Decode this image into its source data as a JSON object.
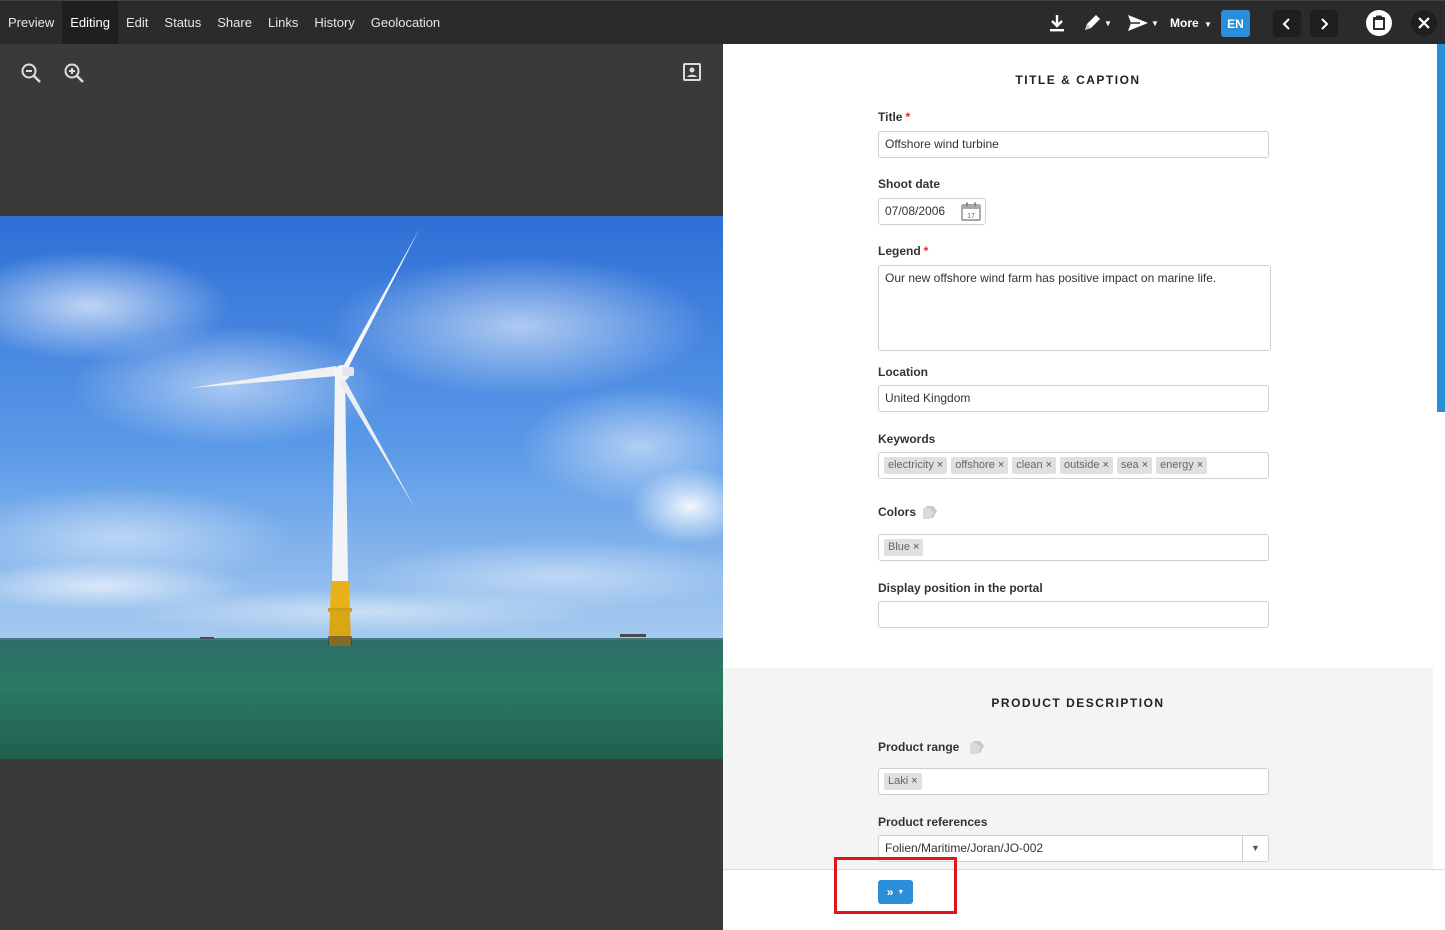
{
  "topbar": {
    "tabs": [
      {
        "label": "Preview",
        "active": false
      },
      {
        "label": "Editing",
        "active": true
      },
      {
        "label": "Edit",
        "active": false
      },
      {
        "label": "Status",
        "active": false
      },
      {
        "label": "Share",
        "active": false
      },
      {
        "label": "Links",
        "active": false
      },
      {
        "label": "History",
        "active": false
      },
      {
        "label": "Geolocation",
        "active": false
      }
    ],
    "more_label": "More",
    "language_label": "EN",
    "accent_color": "#2a8fd8"
  },
  "title_caption": {
    "heading": "TITLE & CAPTION",
    "title_label": "Title",
    "title_value": "Offshore wind turbine",
    "shoot_date_label": "Shoot date",
    "shoot_date_value": "07/08/2006",
    "calendar_day": "17",
    "legend_label": "Legend",
    "legend_value": "Our new offshore wind farm has positive impact on marine life.",
    "location_label": "Location",
    "location_value": "United Kingdom",
    "keywords_label": "Keywords",
    "keywords": [
      "electricity",
      "offshore",
      "clean",
      "outside",
      "sea",
      "energy"
    ],
    "colors_label": "Colors",
    "colors": [
      "Blue"
    ],
    "display_position_label": "Display position in the portal",
    "display_position_value": "",
    "required_mark": "*"
  },
  "product_description": {
    "heading": "PRODUCT DESCRIPTION",
    "product_range_label": "Product range",
    "product_range": [
      "Laki"
    ],
    "product_references_label": "Product references",
    "product_references_value": "Folien/Maritime/Joran/JO-002"
  },
  "footer": {
    "action_label": "»"
  },
  "remove_glyph": "×"
}
